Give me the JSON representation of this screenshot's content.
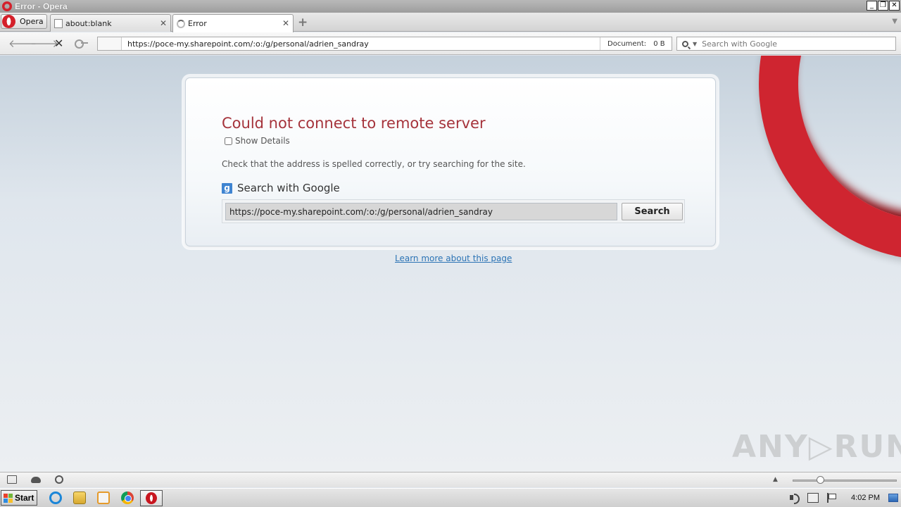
{
  "window": {
    "title": "Error - Opera"
  },
  "tabbar": {
    "menu_label": "Opera",
    "tabs": [
      {
        "label": "about:blank",
        "active": false
      },
      {
        "label": "Error",
        "active": true
      }
    ]
  },
  "navbar": {
    "url": "https://poce-my.sharepoint.com/:o:/g/personal/adrien_sandray",
    "document_label": "Document:",
    "document_size": "0 B",
    "search_placeholder": "Search with Google"
  },
  "error_page": {
    "title": "Could not connect to remote server",
    "show_details_label": "Show Details",
    "hint": "Check that the address is spelled correctly, or try searching for the site.",
    "google_heading": "Search with Google",
    "google_icon": "g",
    "search_value": "https://poce-my.sharepoint.com/:o:/g/personal/adrien_sandray",
    "search_button": "Search",
    "learn_more": "Learn more about this page"
  },
  "watermark": "ANY▷RUN",
  "zoom": {
    "level_fraction": 0.27
  },
  "taskbar": {
    "start_label": "Start",
    "clock": "4:02 PM"
  },
  "colors": {
    "error_title": "#a5333b",
    "link": "#2c74b5",
    "opera_red": "#cf2530"
  }
}
